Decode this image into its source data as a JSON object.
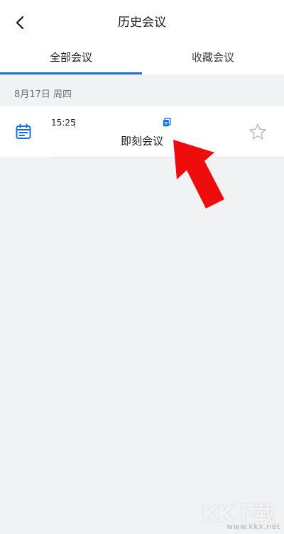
{
  "header": {
    "title": "历史会议"
  },
  "tabs": [
    {
      "label": "全部会议",
      "active": true
    },
    {
      "label": "收藏会议",
      "active": false
    }
  ],
  "date_group": {
    "label": "8月17日  周四"
  },
  "meeting": {
    "time": "15:25",
    "name": "即刻会议",
    "starred": false
  },
  "watermark": {
    "logo": "KK下载",
    "url": "www.kkx.net"
  },
  "colors": {
    "accent": "#1a6fe0",
    "annotation_arrow": "#ee0c0c",
    "background": "#f1f2f4"
  },
  "icons": {
    "back": "chevron-left-icon",
    "calendar": "calendar-icon",
    "copy": "copy-icon",
    "star": "star-outline-icon"
  }
}
